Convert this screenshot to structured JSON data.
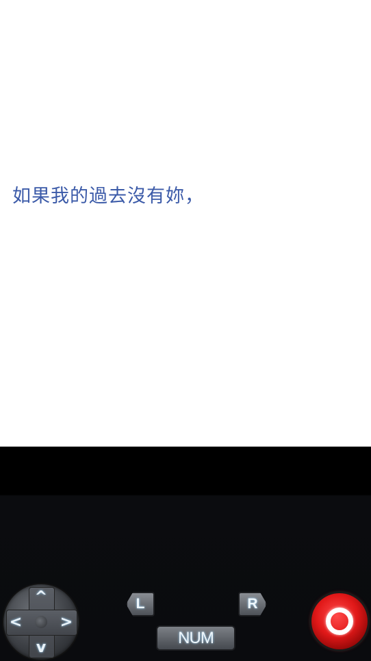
{
  "dialog": {
    "text": "如果我的過去沒有妳，",
    "color": "#3b5aa8"
  },
  "controls": {
    "dpad": {
      "up_icon": "chevron-up-icon",
      "down_icon": "chevron-down-icon",
      "left_icon": "chevron-left-icon",
      "right_icon": "chevron-right-icon",
      "up": "^",
      "down": "v",
      "left": "<",
      "right": ">"
    },
    "l_button": "L",
    "r_button": "R",
    "num_button": "NUM",
    "action_button_icon": "circle-o-icon",
    "action_color": "#e01818"
  }
}
